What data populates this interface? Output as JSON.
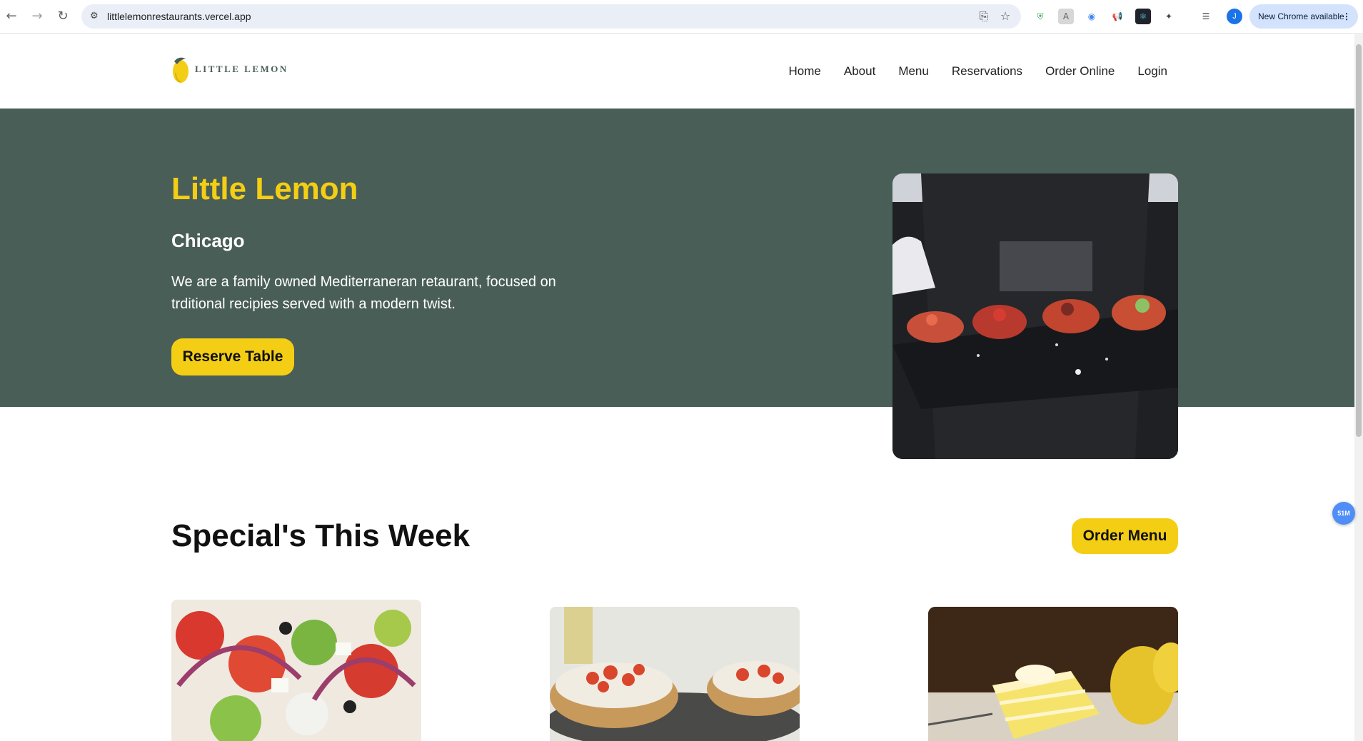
{
  "browser": {
    "url": "littlelemonrestaurants.vercel.app",
    "update_label": "New Chrome available",
    "profile_initial": "J"
  },
  "header": {
    "logo_text": "LITTLE LEMON",
    "nav": [
      "Home",
      "About",
      "Menu",
      "Reservations",
      "Order Online",
      "Login"
    ]
  },
  "hero": {
    "title": "Little Lemon",
    "subtitle": "Chicago",
    "description": "We are a family owned Mediterraneran retaurant, focused on trditional recipies served with a modern twist.",
    "button_label": "Reserve Table"
  },
  "specials": {
    "title": "Special's This Week",
    "button_label": "Order Menu"
  },
  "floating_badge": "51M",
  "colors": {
    "brand_green": "#495e57",
    "brand_yellow": "#f4ce14"
  }
}
